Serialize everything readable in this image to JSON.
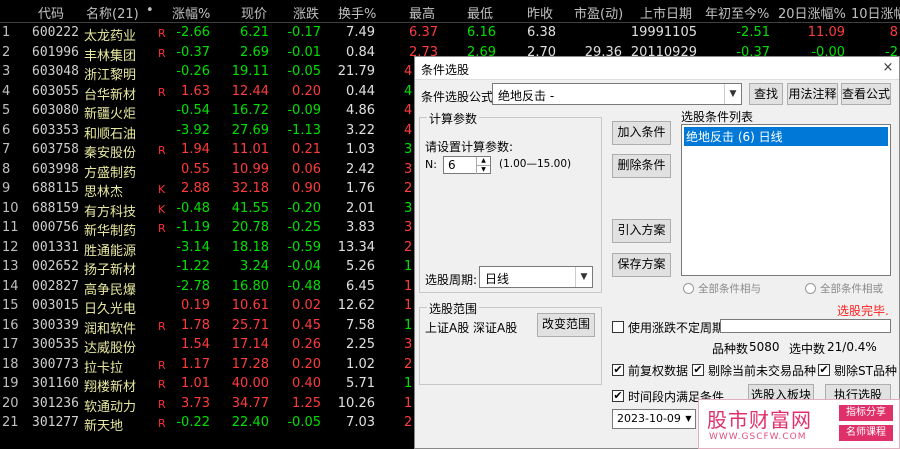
{
  "table": {
    "headers": [
      "代码",
      "名称(21)",
      "•",
      "涨幅%",
      "现价",
      "涨跌",
      "换手%",
      "最高",
      "最低",
      "昨收",
      "市盈(动)",
      "上市日期",
      "年初至今%",
      "20日涨幅%",
      "10日涨幅"
    ],
    "rows": [
      {
        "idx": "1",
        "code": "600222",
        "name": "太龙药业",
        "flag": "R",
        "chg": "-2.66",
        "price": "6.21",
        "diff": "-0.17",
        "turn": "7.49",
        "high": "6.37",
        "low": "6.16",
        "prev": "6.38",
        "pe": "",
        "list": "19991105",
        "ytd": "-2.51",
        "d20": "11.09",
        "d10": "8"
      },
      {
        "idx": "2",
        "code": "601996",
        "name": "丰林集团",
        "flag": "R",
        "chg": "-0.37",
        "price": "2.69",
        "diff": "-0.01",
        "turn": "0.84",
        "high": "2.73",
        "low": "2.69",
        "prev": "2.70",
        "pe": "29.36",
        "list": "20110929",
        "ytd": "-0.37",
        "d20": "-0.00",
        "d10": "-2"
      },
      {
        "idx": "3",
        "code": "603048",
        "name": "浙江黎明",
        "flag": "",
        "chg": "-0.26",
        "price": "19.11",
        "diff": "-0.05",
        "turn": "21.79",
        "high": "",
        "low": "",
        "prev": "",
        "pe": "",
        "list": "",
        "ytd": "",
        "d20": "",
        "d10": ""
      },
      {
        "idx": "4",
        "code": "603055",
        "name": "台华新材",
        "flag": "R",
        "chg": "1.63",
        "price": "12.44",
        "diff": "0.20",
        "turn": "0.44",
        "high": "",
        "low": "",
        "prev": "",
        "pe": "",
        "list": "",
        "ytd": "",
        "d20": "",
        "d10": ""
      },
      {
        "idx": "5",
        "code": "603080",
        "name": "新疆火炬",
        "flag": "",
        "chg": "-0.54",
        "price": "16.72",
        "diff": "-0.09",
        "turn": "4.86",
        "high": "",
        "low": "",
        "prev": "",
        "pe": "",
        "list": "",
        "ytd": "",
        "d20": "",
        "d10": ""
      },
      {
        "idx": "6",
        "code": "603353",
        "name": "和顺石油",
        "flag": "",
        "chg": "-3.92",
        "price": "27.69",
        "diff": "-1.13",
        "turn": "3.22",
        "high": "",
        "low": "",
        "prev": "",
        "pe": "",
        "list": "",
        "ytd": "",
        "d20": "",
        "d10": ""
      },
      {
        "idx": "7",
        "code": "603758",
        "name": "秦安股份",
        "flag": "R",
        "chg": "1.94",
        "price": "11.01",
        "diff": "0.21",
        "turn": "1.03",
        "high": "",
        "low": "",
        "prev": "",
        "pe": "",
        "list": "",
        "ytd": "",
        "d20": "",
        "d10": ""
      },
      {
        "idx": "8",
        "code": "603998",
        "name": "方盛制药",
        "flag": "",
        "chg": "0.55",
        "price": "10.99",
        "diff": "0.06",
        "turn": "2.42",
        "high": "",
        "low": "",
        "prev": "",
        "pe": "",
        "list": "",
        "ytd": "",
        "d20": "",
        "d10": ""
      },
      {
        "idx": "9",
        "code": "688115",
        "name": "思林杰",
        "flag": "K",
        "chg": "2.88",
        "price": "32.18",
        "diff": "0.90",
        "turn": "1.76",
        "high": "",
        "low": "",
        "prev": "",
        "pe": "",
        "list": "",
        "ytd": "",
        "d20": "",
        "d10": ""
      },
      {
        "idx": "10",
        "code": "688159",
        "name": "有方科技",
        "flag": "K",
        "chg": "-0.48",
        "price": "41.55",
        "diff": "-0.20",
        "turn": "2.01",
        "high": "",
        "low": "",
        "prev": "",
        "pe": "",
        "list": "",
        "ytd": "",
        "d20": "",
        "d10": ""
      },
      {
        "idx": "11",
        "code": "000756",
        "name": "新华制药",
        "flag": "R",
        "chg": "-1.19",
        "price": "20.78",
        "diff": "-0.25",
        "turn": "3.83",
        "high": "",
        "low": "",
        "prev": "",
        "pe": "",
        "list": "",
        "ytd": "",
        "d20": "",
        "d10": ""
      },
      {
        "idx": "12",
        "code": "001331",
        "name": "胜通能源",
        "flag": "",
        "chg": "-3.14",
        "price": "18.18",
        "diff": "-0.59",
        "turn": "13.34",
        "high": "",
        "low": "",
        "prev": "",
        "pe": "",
        "list": "",
        "ytd": "",
        "d20": "",
        "d10": ""
      },
      {
        "idx": "13",
        "code": "002652",
        "name": "扬子新材",
        "flag": "",
        "chg": "-1.22",
        "price": "3.24",
        "diff": "-0.04",
        "turn": "5.26",
        "high": "",
        "low": "",
        "prev": "",
        "pe": "",
        "list": "",
        "ytd": "",
        "d20": "",
        "d10": ""
      },
      {
        "idx": "14",
        "code": "002827",
        "name": "高争民爆",
        "flag": "",
        "chg": "-2.78",
        "price": "16.80",
        "diff": "-0.48",
        "turn": "6.45",
        "high": "",
        "low": "",
        "prev": "",
        "pe": "",
        "list": "",
        "ytd": "",
        "d20": "",
        "d10": ""
      },
      {
        "idx": "15",
        "code": "003015",
        "name": "日久光电",
        "flag": "",
        "chg": "0.19",
        "price": "10.61",
        "diff": "0.02",
        "turn": "12.62",
        "high": "",
        "low": "",
        "prev": "",
        "pe": "",
        "list": "",
        "ytd": "",
        "d20": "",
        "d10": ""
      },
      {
        "idx": "16",
        "code": "300339",
        "name": "润和软件",
        "flag": "R",
        "chg": "1.78",
        "price": "25.71",
        "diff": "0.45",
        "turn": "7.58",
        "high": "",
        "low": "",
        "prev": "",
        "pe": "",
        "list": "",
        "ytd": "",
        "d20": "",
        "d10": ""
      },
      {
        "idx": "17",
        "code": "300535",
        "name": "达威股份",
        "flag": "",
        "chg": "1.54",
        "price": "17.14",
        "diff": "0.26",
        "turn": "2.25",
        "high": "",
        "low": "",
        "prev": "",
        "pe": "",
        "list": "",
        "ytd": "",
        "d20": "",
        "d10": ""
      },
      {
        "idx": "18",
        "code": "300773",
        "name": "拉卡拉",
        "flag": "R",
        "chg": "1.17",
        "price": "17.28",
        "diff": "0.20",
        "turn": "1.02",
        "high": "",
        "low": "",
        "prev": "",
        "pe": "",
        "list": "",
        "ytd": "",
        "d20": "",
        "d10": ""
      },
      {
        "idx": "19",
        "code": "301160",
        "name": "翔楼新材",
        "flag": "R",
        "chg": "1.01",
        "price": "40.00",
        "diff": "0.40",
        "turn": "5.71",
        "high": "",
        "low": "",
        "prev": "",
        "pe": "",
        "list": "",
        "ytd": "",
        "d20": "",
        "d10": ""
      },
      {
        "idx": "20",
        "code": "301236",
        "name": "软通动力",
        "flag": "R",
        "chg": "3.73",
        "price": "34.77",
        "diff": "1.25",
        "turn": "10.26",
        "high": "",
        "low": "",
        "prev": "",
        "pe": "",
        "list": "",
        "ytd": "",
        "d20": "",
        "d10": ""
      },
      {
        "idx": "21",
        "code": "301277",
        "name": "新天地",
        "flag": "R",
        "chg": "-0.22",
        "price": "22.40",
        "diff": "-0.05",
        "turn": "7.03",
        "high": "",
        "low": "",
        "prev": "",
        "pe": "",
        "list": "",
        "ytd": "",
        "d20": "",
        "d10": ""
      }
    ],
    "partial_left_col": [
      "4",
      "4",
      "4",
      "4",
      "3",
      "3",
      "2",
      "3",
      "3",
      "2",
      "1",
      "1",
      "1",
      "1",
      "3",
      "2",
      "1",
      "1",
      "2"
    ]
  },
  "dialog": {
    "title": "条件选股",
    "close_glyph": "×",
    "formula_label": "条件选股公式",
    "formula_value": "绝地反击 -",
    "btn_find": "查找",
    "btn_usage": "用法注释",
    "btn_view": "查看公式",
    "params_group": "计算参数",
    "params_prompt": "请设置计算参数:",
    "param_name": "N:",
    "param_value": "6",
    "param_range": "(1.00—15.00)",
    "period_label": "选股周期:",
    "period_value": "日线",
    "btn_add": "加入条件",
    "btn_delete": "删除条件",
    "btn_import": "引入方案",
    "btn_save": "保存方案",
    "list_label": "选股条件列表",
    "list_items": [
      "绝地反击 (6) 日线"
    ],
    "radio_and": "全部条件相与",
    "radio_or": "全部条件相或",
    "status_text": "选股完毕.",
    "range_group": "选股范围",
    "range_value": "上证A股 深证A股",
    "btn_change_range": "改变范围",
    "chk_uncertain": "使用涨跌不定周期",
    "total_label": "品种数",
    "total_value": "5080",
    "selected_label": "选中数",
    "selected_value": "21/0.4%",
    "chk_adjust": "前复权数据",
    "chk_remove_untraded": "剔除当前未交易品种",
    "chk_remove_st": "剔除ST品种",
    "chk_time_range": "时间段内满足条件",
    "date_value": "2023-10-09",
    "btn_partial1": "选股入板块",
    "btn_partial2": "执行选股"
  },
  "watermark": {
    "main": "股市财富网",
    "url": "WWW.GSCFW.COM",
    "tag1": "指标分享",
    "tag2": "名师课程"
  },
  "colors": {
    "up": "#ff3c3c",
    "down": "#00e000",
    "flag": "#ff3030",
    "name": "#e8e8a0",
    "highlight": "#0078d7"
  }
}
